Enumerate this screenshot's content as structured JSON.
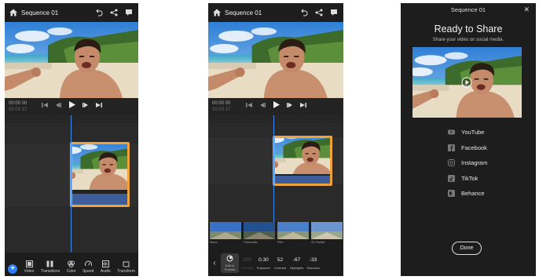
{
  "app": {
    "sequence_title": "Sequence 01"
  },
  "editor": {
    "timecode_current": "00:00 00",
    "timecode_total": "00:03 37"
  },
  "phone1": {
    "bottom_tools": [
      {
        "label": "Video",
        "icon": "video-icon"
      },
      {
        "label": "Transitions",
        "icon": "transitions-icon"
      },
      {
        "label": "Color",
        "icon": "color-icon"
      },
      {
        "label": "Speed",
        "icon": "speed-icon"
      },
      {
        "label": "Audio",
        "icon": "audio-icon"
      },
      {
        "label": "Transform",
        "icon": "transform-icon"
      }
    ]
  },
  "phone2": {
    "filters": [
      {
        "label": "None"
      },
      {
        "label": "Cinematic"
      },
      {
        "label": "Film"
      },
      {
        "label": "SL Faded"
      }
    ],
    "adjustments": [
      {
        "label": "Edit in Presets",
        "value": "",
        "selected": true
      },
      {
        "label": "Intensity",
        "value": "100",
        "disabled": true
      },
      {
        "label": "Exposure",
        "value": "0.30"
      },
      {
        "label": "Contrast",
        "value": "52"
      },
      {
        "label": "Highlights",
        "value": "-67"
      },
      {
        "label": "Shadows",
        "value": "-33"
      }
    ]
  },
  "share": {
    "header": "Sequence 01",
    "heading": "Ready to Share",
    "subheading": "Share your video on social media.",
    "destinations": [
      {
        "label": "YouTube",
        "icon": "youtube-icon"
      },
      {
        "label": "Facebook",
        "icon": "facebook-icon"
      },
      {
        "label": "Instagram",
        "icon": "instagram-icon"
      },
      {
        "label": "TikTok",
        "icon": "tiktok-icon"
      },
      {
        "label": "Behance",
        "icon": "behance-icon"
      }
    ],
    "done_label": "Done"
  },
  "colors": {
    "accent_blue": "#2c7ef6",
    "clip_border": "#f0a33a",
    "panel_bg": "#1d1d1d"
  }
}
